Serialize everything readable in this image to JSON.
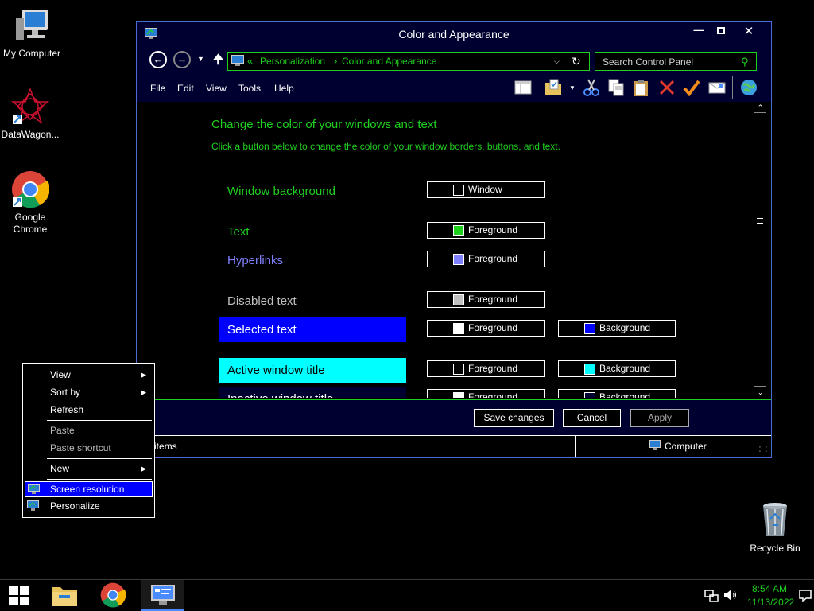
{
  "desktop": {
    "icons": [
      {
        "label": "My Computer"
      },
      {
        "label": "DataWagon..."
      },
      {
        "label": "Google Chrome"
      },
      {
        "label": "Recycle Bin"
      }
    ]
  },
  "window": {
    "title": "Color and Appearance",
    "address": {
      "sep": "«",
      "crumb1": "Personalization",
      "arrow": "›",
      "crumb2": "Color and Appearance"
    },
    "search_placeholder": "Search Control Panel",
    "menu": [
      "File",
      "Edit",
      "View",
      "Tools",
      "Help"
    ],
    "heading": "Change the color of your windows and text",
    "subheading": "Click a button below to change the color of your window borders, buttons, and text.",
    "rows": [
      {
        "label": "Window background",
        "color": "#1fd01f",
        "btn1": {
          "text": "Window",
          "swatch": "#000000"
        }
      },
      {
        "label": "Text",
        "color": "#1fd01f",
        "btn1": {
          "text": "Foreground",
          "swatch": "#1fd01f"
        }
      },
      {
        "label": "Hyperlinks",
        "color": "#8080ff",
        "btn1": {
          "text": "Foreground",
          "swatch": "#8080ff"
        }
      },
      {
        "label": "Disabled text",
        "color": "#c0c0c0",
        "btn1": {
          "text": "Foreground",
          "swatch": "#c0c0c0"
        }
      },
      {
        "label": "Selected text",
        "color": "#ffffff",
        "bg": "#0000ff",
        "btn1": {
          "text": "Foreground",
          "swatch": "#ffffff"
        },
        "btn2": {
          "text": "Background",
          "swatch": "#0000ff"
        }
      },
      {
        "label": "Active window title",
        "color": "#000000",
        "bg": "#00ffff",
        "btn1": {
          "text": "Foreground",
          "swatch": "#000000"
        },
        "btn2": {
          "text": "Background",
          "swatch": "#00ffff"
        }
      },
      {
        "label": "Inactive window title",
        "color": "#ffffff",
        "bg": "#000030",
        "btn1": {
          "text": "Foreground",
          "swatch": "#ffffff"
        },
        "btn2": {
          "text": "Background",
          "swatch": "#000030"
        }
      }
    ],
    "buttons": {
      "save": "Save changes",
      "cancel": "Cancel",
      "apply": "Apply"
    },
    "status": {
      "left": "items",
      "right": "Computer"
    }
  },
  "context_menu": {
    "view": "View",
    "sort_by": "Sort by",
    "refresh": "Refresh",
    "paste": "Paste",
    "paste_shortcut": "Paste shortcut",
    "new": "New",
    "screen_resolution": "Screen resolution",
    "personalize": "Personalize"
  },
  "taskbar": {
    "time": "8:54 AM",
    "date": "11/13/2022"
  },
  "colors": {
    "accent_green": "#1fd01f",
    "selection_blue": "#0000ff",
    "window_dark": "#000030"
  }
}
